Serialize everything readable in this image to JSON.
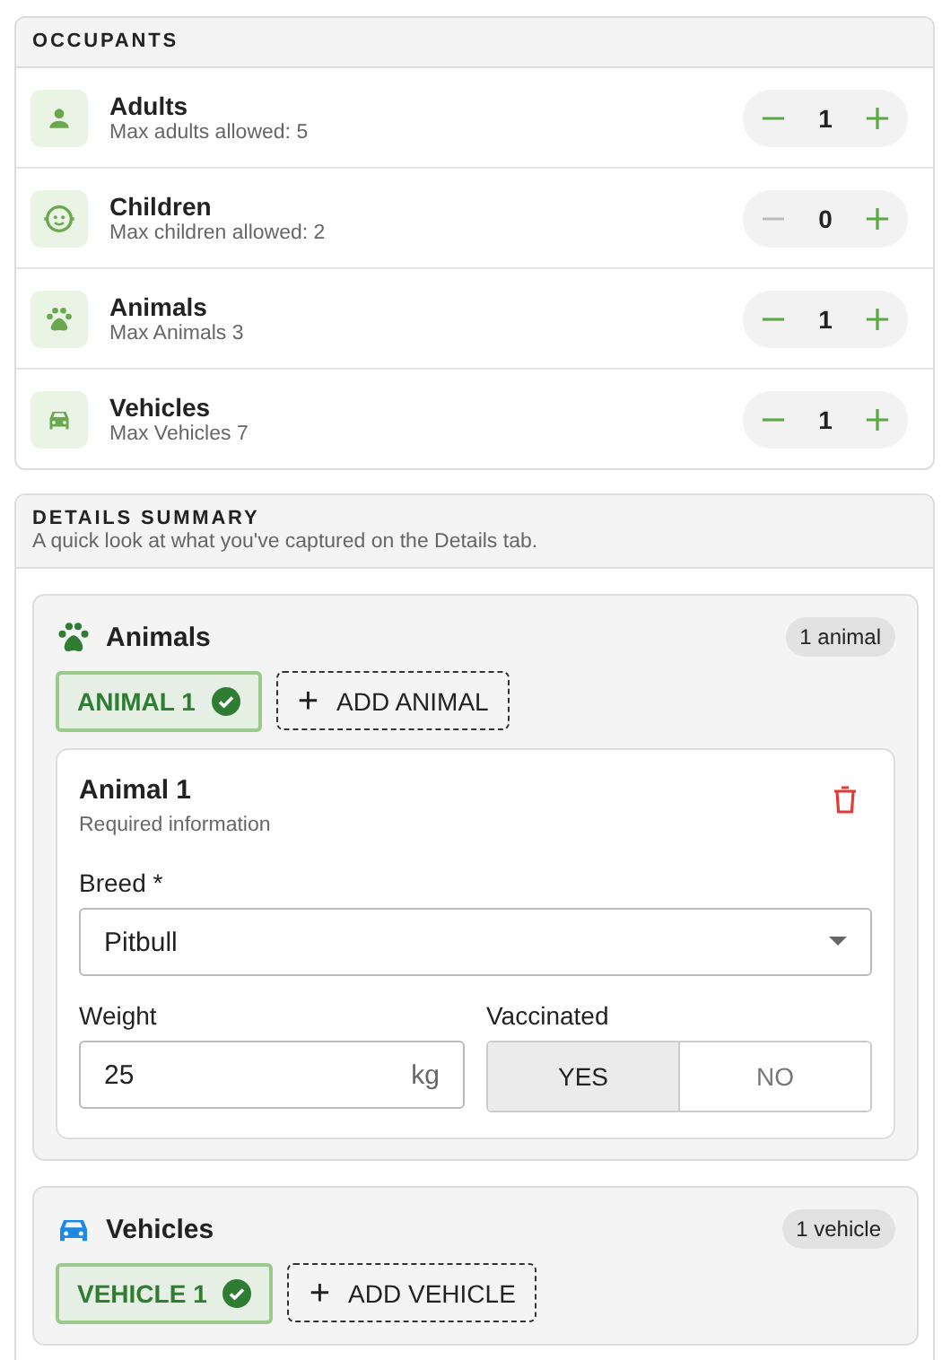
{
  "occupants": {
    "title": "OCCUPANTS",
    "rows": [
      {
        "kind": "person",
        "label": "Adults",
        "hint": "Max adults allowed: 5",
        "count": "1",
        "minus_disabled": false
      },
      {
        "kind": "baby",
        "label": "Children",
        "hint": "Max children allowed: 2",
        "count": "0",
        "minus_disabled": true
      },
      {
        "kind": "paw",
        "label": "Animals",
        "hint": "Max Animals 3",
        "count": "1",
        "minus_disabled": false
      },
      {
        "kind": "car",
        "label": "Vehicles",
        "hint": "Max Vehicles 7",
        "count": "1",
        "minus_disabled": false
      }
    ]
  },
  "summary": {
    "title": "DETAILS SUMMARY",
    "subtitle": "A quick look at what you've captured on the Details tab.",
    "groups": [
      {
        "kind": "paw",
        "title": "Animals",
        "badge": "1 animal",
        "chips": [
          {
            "label": "ANIMAL 1",
            "selected": true
          }
        ],
        "add_label": "ADD ANIMAL",
        "plus": "+",
        "detail": {
          "title": "Animal 1",
          "subtitle": "Required information",
          "breed_label": "Breed *",
          "breed_value": "Pitbull",
          "weight_label": "Weight",
          "weight_value": "25",
          "weight_unit": "kg",
          "vaccinated_label": "Vaccinated",
          "options": [
            {
              "label": "YES",
              "selected": true
            },
            {
              "label": "NO",
              "selected": false
            }
          ]
        }
      },
      {
        "kind": "car",
        "title": "Vehicles",
        "badge": "1 vehicle",
        "chips": [
          {
            "label": "VEHICLE 1",
            "selected": true
          }
        ],
        "add_label": "ADD VEHICLE",
        "plus": "+"
      }
    ]
  }
}
